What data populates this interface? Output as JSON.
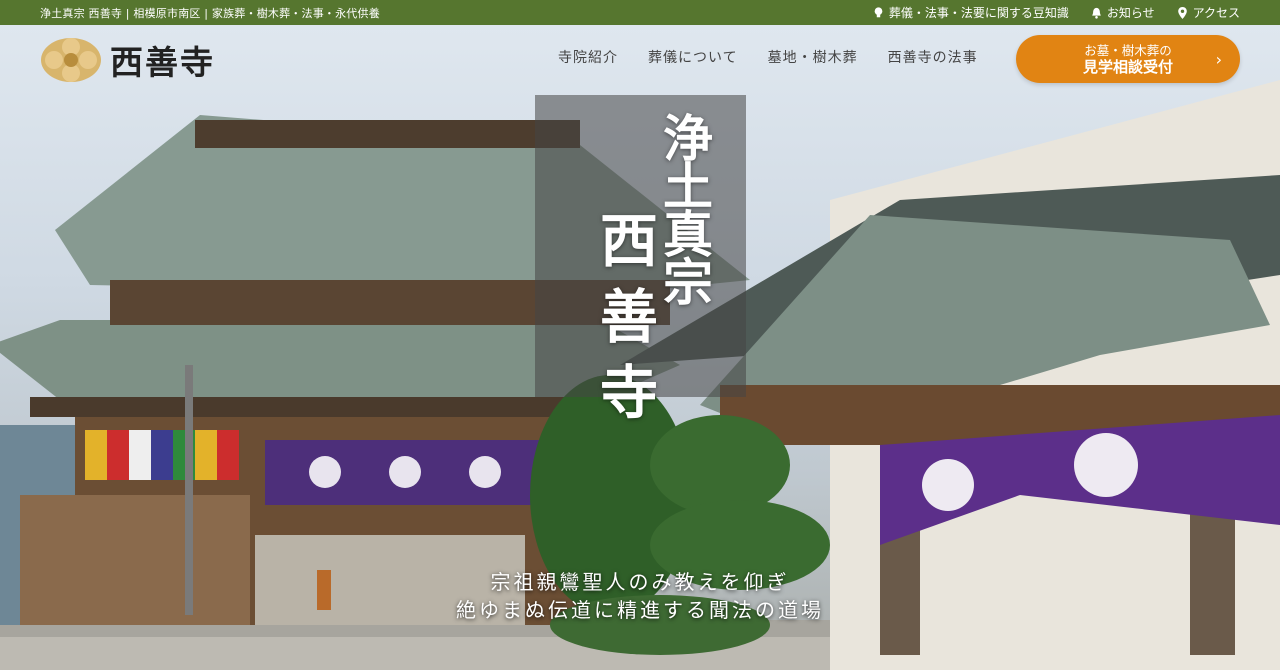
{
  "topbar": {
    "breadcrumb": "浄土真宗 西善寺 | 相模原市南区 | 家族葬・樹木葬・法事・永代供養",
    "links": [
      {
        "label": "葬儀・法事・法要に関する豆知識",
        "icon": "bulb-icon"
      },
      {
        "label": "お知らせ",
        "icon": "bell-icon"
      },
      {
        "label": "アクセス",
        "icon": "map-pin-icon"
      }
    ],
    "bg_color": "#56762f"
  },
  "header": {
    "logo_text": "西善寺",
    "nav": [
      "寺院紹介",
      "葬儀について",
      "墓地・樹木葬",
      "西善寺の法事"
    ],
    "cta": {
      "line1": "お墓・樹木葬の",
      "line2": "見学相談受付",
      "color": "#e18413"
    }
  },
  "hero": {
    "calligraphy_top": "浄土真宗",
    "calligraphy_main": "西善寺",
    "tagline_1": "宗祖親鸞聖人のみ教えを仰ぎ",
    "tagline_2": "絶ゆまぬ伝道に精進する聞法の道場"
  }
}
